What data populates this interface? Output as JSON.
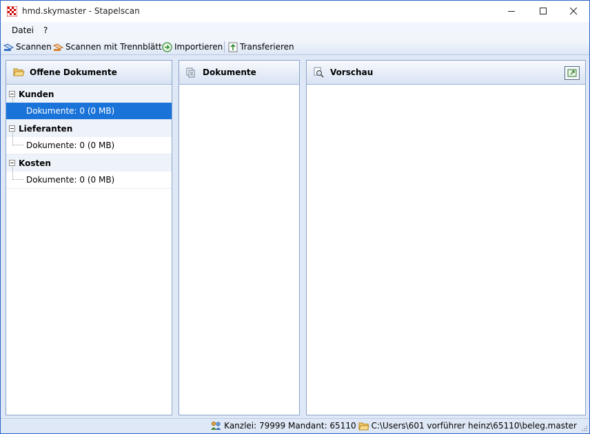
{
  "window": {
    "title": "hmd.skymaster - Stapelscan"
  },
  "menu": {
    "items": [
      "Datei",
      "?"
    ]
  },
  "toolbar": {
    "scan_label": "Scannen",
    "scan_separator_label": "Scannen mit Trennblätter",
    "import_label": "Importieren",
    "transfer_label": "Transferieren"
  },
  "panels": {
    "open_documents": {
      "title": "Offene Dokumente",
      "groups": [
        {
          "label": "Kunden",
          "child": "Dokumente: 0 (0 MB)",
          "selected": true
        },
        {
          "label": "Lieferanten",
          "child": "Dokumente: 0 (0 MB)",
          "selected": false
        },
        {
          "label": "Kosten",
          "child": "Dokumente: 0 (0 MB)",
          "selected": false
        }
      ]
    },
    "documents": {
      "title": "Dokumente"
    },
    "preview": {
      "title": "Vorschau"
    }
  },
  "status": {
    "text": "Kanzlei: 79999 Mandant: 65110",
    "path": "C:\\Users\\601 vorführer heinz\\65110\\beleg.master"
  },
  "colors": {
    "selection": "#1a73d9",
    "border": "#2b66c7"
  }
}
